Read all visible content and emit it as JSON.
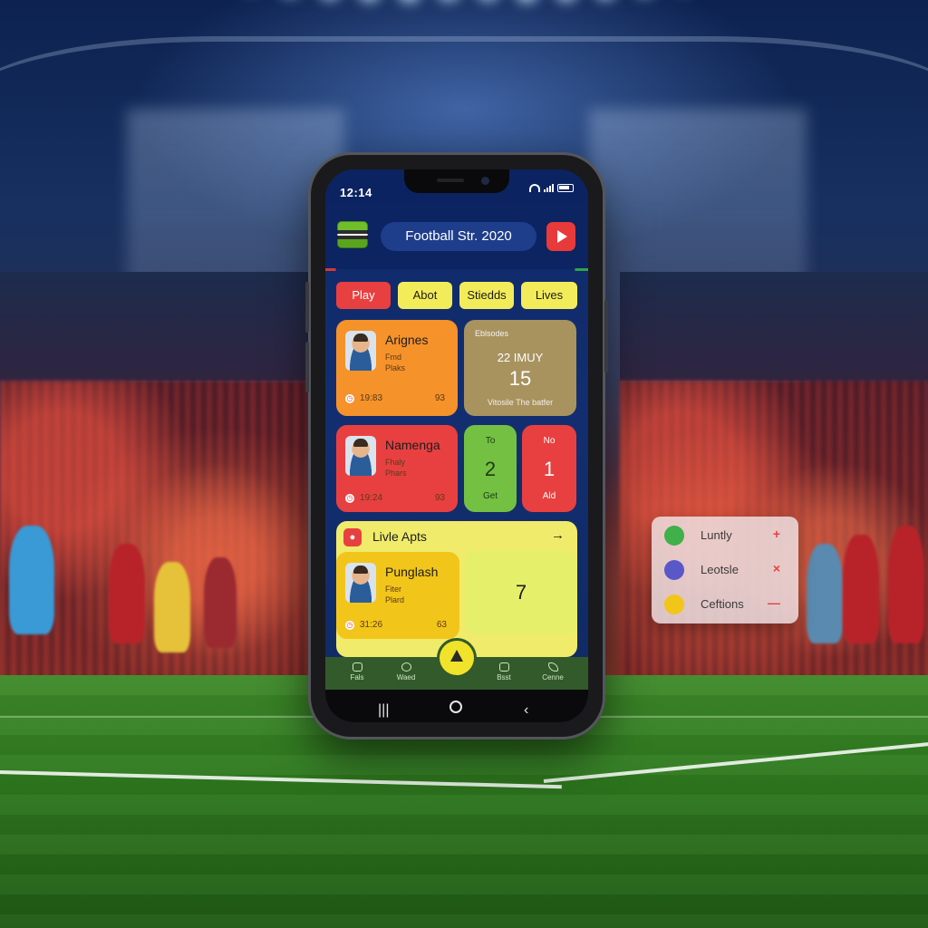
{
  "status_bar": {
    "time": "12:14"
  },
  "header": {
    "title": "Football Str. 2020"
  },
  "tabs": [
    {
      "label": "Play",
      "color": "#e84040"
    },
    {
      "label": "Abot",
      "color": "#f2ec5a"
    },
    {
      "label": "Stiedds",
      "color": "#f2ec5a"
    },
    {
      "label": "Lives",
      "color": "#f2ec5a"
    }
  ],
  "cards": {
    "player1": {
      "name": "Arignes",
      "line1": "Fmd",
      "line2": "Plaks",
      "stat": "19:83",
      "number": "93",
      "color": "#f5922a"
    },
    "date_card": {
      "header": "Eblsodes",
      "month": "22 IMUY",
      "day": "15",
      "footer": "Vitosile The batfer"
    },
    "player2": {
      "name": "Namenga",
      "line1": "Fhaly",
      "line2": "Phars",
      "stat": "19:24",
      "number": "93",
      "color": "#e84040"
    },
    "score_home": {
      "label": "To",
      "value": "2",
      "footer": "Get",
      "color": "#74c043"
    },
    "score_away": {
      "label": "No",
      "value": "1",
      "footer": "Ald",
      "color": "#e84040"
    }
  },
  "live": {
    "title": "Livle Apts",
    "player": {
      "name": "Punglash",
      "line1": "Fiter",
      "line2": "Plard",
      "stat": "31:26",
      "number": "63",
      "color": "#f2c51a"
    },
    "score": "7"
  },
  "bottom_nav": [
    {
      "label": "Fals"
    },
    {
      "label": "Waed"
    },
    {
      "label": ""
    },
    {
      "label": "Bsst"
    },
    {
      "label": "Cenne"
    }
  ],
  "floating_widget": {
    "items": [
      {
        "label": "Luntly",
        "action": "+",
        "icon_color": "#3fb04a"
      },
      {
        "label": "Leotsle",
        "action": "×",
        "icon_color": "#5a57c9"
      },
      {
        "label": "Ceftions",
        "action": "—",
        "icon_color": "#f2c51a"
      }
    ]
  }
}
